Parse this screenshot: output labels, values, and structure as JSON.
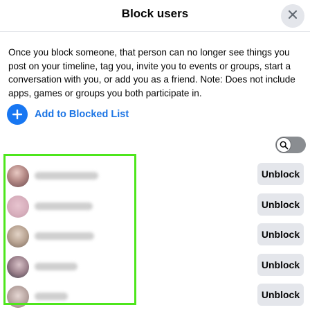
{
  "dialog": {
    "title": "Block users",
    "description": "Once you block someone, that person can no longer see things you post on your timeline, tag you, invite you to events or groups, start a conversation with you, or add you as a friend. Note: Does not include apps, games or groups you both participate in.",
    "add_label": "Add to Blocked List"
  },
  "colors": {
    "accent": "#1877f2",
    "accent_text": "#1b74e4",
    "button_bg": "#e4e6eb",
    "highlight": "#4ee61c"
  },
  "icons": {
    "close": "close-icon",
    "add": "plus-icon",
    "search": "search-icon"
  },
  "blocked_users": [
    {
      "unblock_label": "Unblock"
    },
    {
      "unblock_label": "Unblock"
    },
    {
      "unblock_label": "Unblock"
    },
    {
      "unblock_label": "Unblock"
    },
    {
      "unblock_label": "Unblock"
    }
  ]
}
